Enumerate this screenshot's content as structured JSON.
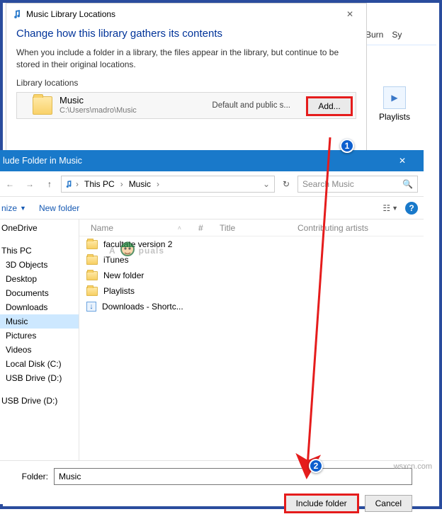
{
  "dlg1": {
    "title": "Music Library Locations",
    "heading": "Change how this library gathers its contents",
    "desc": "When you include a folder in a library, the files appear in the library, but continue to be stored in their original locations.",
    "section": "Library locations",
    "entry": {
      "name": "Music",
      "path": "C:\\Users\\madro\\Music",
      "status": "Default and public s..."
    },
    "add_label": "Add..."
  },
  "bg": {
    "tab_burn": "Burn",
    "tab_sync": "Sy",
    "playlists": "Playlists"
  },
  "dlg2": {
    "title": "lude Folder in Music",
    "breadcrumb": {
      "root": "This PC",
      "sub": "Music"
    },
    "search_placeholder": "Search Music",
    "toolbar": {
      "organize": "nize",
      "newfolder": "New folder"
    },
    "columns": {
      "name": "Name",
      "hash": "#",
      "title": "Title",
      "artists": "Contributing artists"
    },
    "tree": [
      "OneDrive",
      "",
      "This PC",
      "3D Objects",
      "Desktop",
      "Documents",
      "Downloads",
      "Music",
      "Pictures",
      "Videos",
      "Local Disk (C:)",
      "USB Drive (D:)",
      "",
      "USB Drive (D:)"
    ],
    "files": [
      {
        "name": "facultate version 2",
        "type": "folder"
      },
      {
        "name": "iTunes",
        "type": "folder"
      },
      {
        "name": "New folder",
        "type": "folder"
      },
      {
        "name": "Playlists",
        "type": "folder"
      },
      {
        "name": "Downloads - Shortc...",
        "type": "shortcut"
      }
    ],
    "footer": {
      "label": "Folder:",
      "value": "Music",
      "include": "Include folder",
      "cancel": "Cancel"
    }
  },
  "watermark": {
    "pre": "A",
    "post": "puals"
  },
  "wsxcn": "wsxcn.com",
  "anno": {
    "one": "1",
    "two": "2"
  }
}
